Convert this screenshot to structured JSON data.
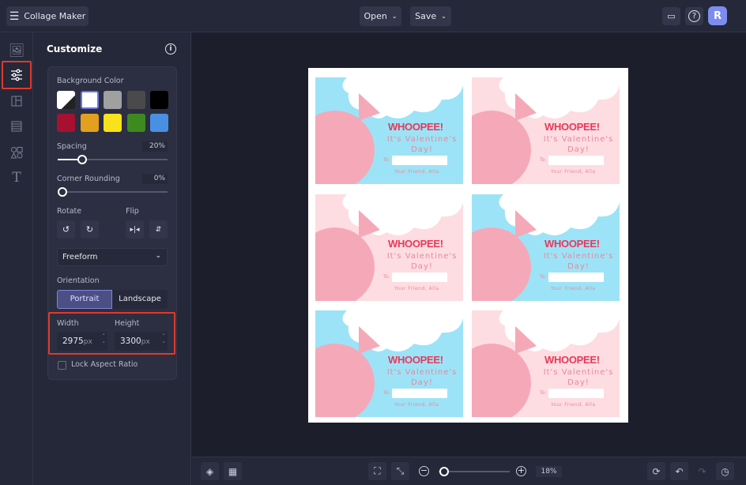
{
  "app": {
    "title": "Collage Maker",
    "menu_icon": "hamburger-icon"
  },
  "topbar": {
    "open_label": "Open",
    "save_label": "Save",
    "avatar_initial": "R",
    "avatar_color": "#7d8cf0"
  },
  "rail": {
    "items": [
      "image-icon",
      "sliders-icon",
      "layout-icon",
      "texture-icon",
      "shapes-icon",
      "text-icon"
    ],
    "active": "sliders-icon"
  },
  "panel": {
    "title": "Customize",
    "background_label": "Background Color",
    "colors": [
      "transparent",
      "#ffffff",
      "#a0a0a0",
      "#4a4a4a",
      "#000000",
      "#a8102f",
      "#e2a01e",
      "#f7e21b",
      "#3d8a1f",
      "#4a90e2"
    ],
    "selected_color": "#ffffff",
    "spacing_label": "Spacing",
    "spacing_value": "20%",
    "spacing": 20,
    "corner_label": "Corner Rounding",
    "corner_value": "0%",
    "corner": 0,
    "rotate_label": "Rotate",
    "flip_label": "Flip",
    "ratio_value": "Freeform",
    "orientation_label": "Orientation",
    "portrait_label": "Portrait",
    "landscape_label": "Landscape",
    "orientation": "Portrait",
    "width_label": "Width",
    "height_label": "Height",
    "width_value": "2975",
    "height_value": "3300",
    "unit": "px",
    "lock_label": "Lock Aspect Ratio",
    "lock_checked": false
  },
  "canvas": {
    "cards": [
      {
        "bg": "#9de3f7"
      },
      {
        "bg": "#fddde1"
      },
      {
        "bg": "#fddde1"
      },
      {
        "bg": "#9de3f7"
      },
      {
        "bg": "#9de3f7"
      },
      {
        "bg": "#fddde1"
      }
    ],
    "card_title": "WHOOPEE!",
    "card_line1": "It's Valentine's",
    "card_line2": "Day!",
    "card_to": "To:",
    "card_from": "Your Friend, Alla"
  },
  "bottombar": {
    "zoom_value": "18%",
    "zoom": 18
  }
}
